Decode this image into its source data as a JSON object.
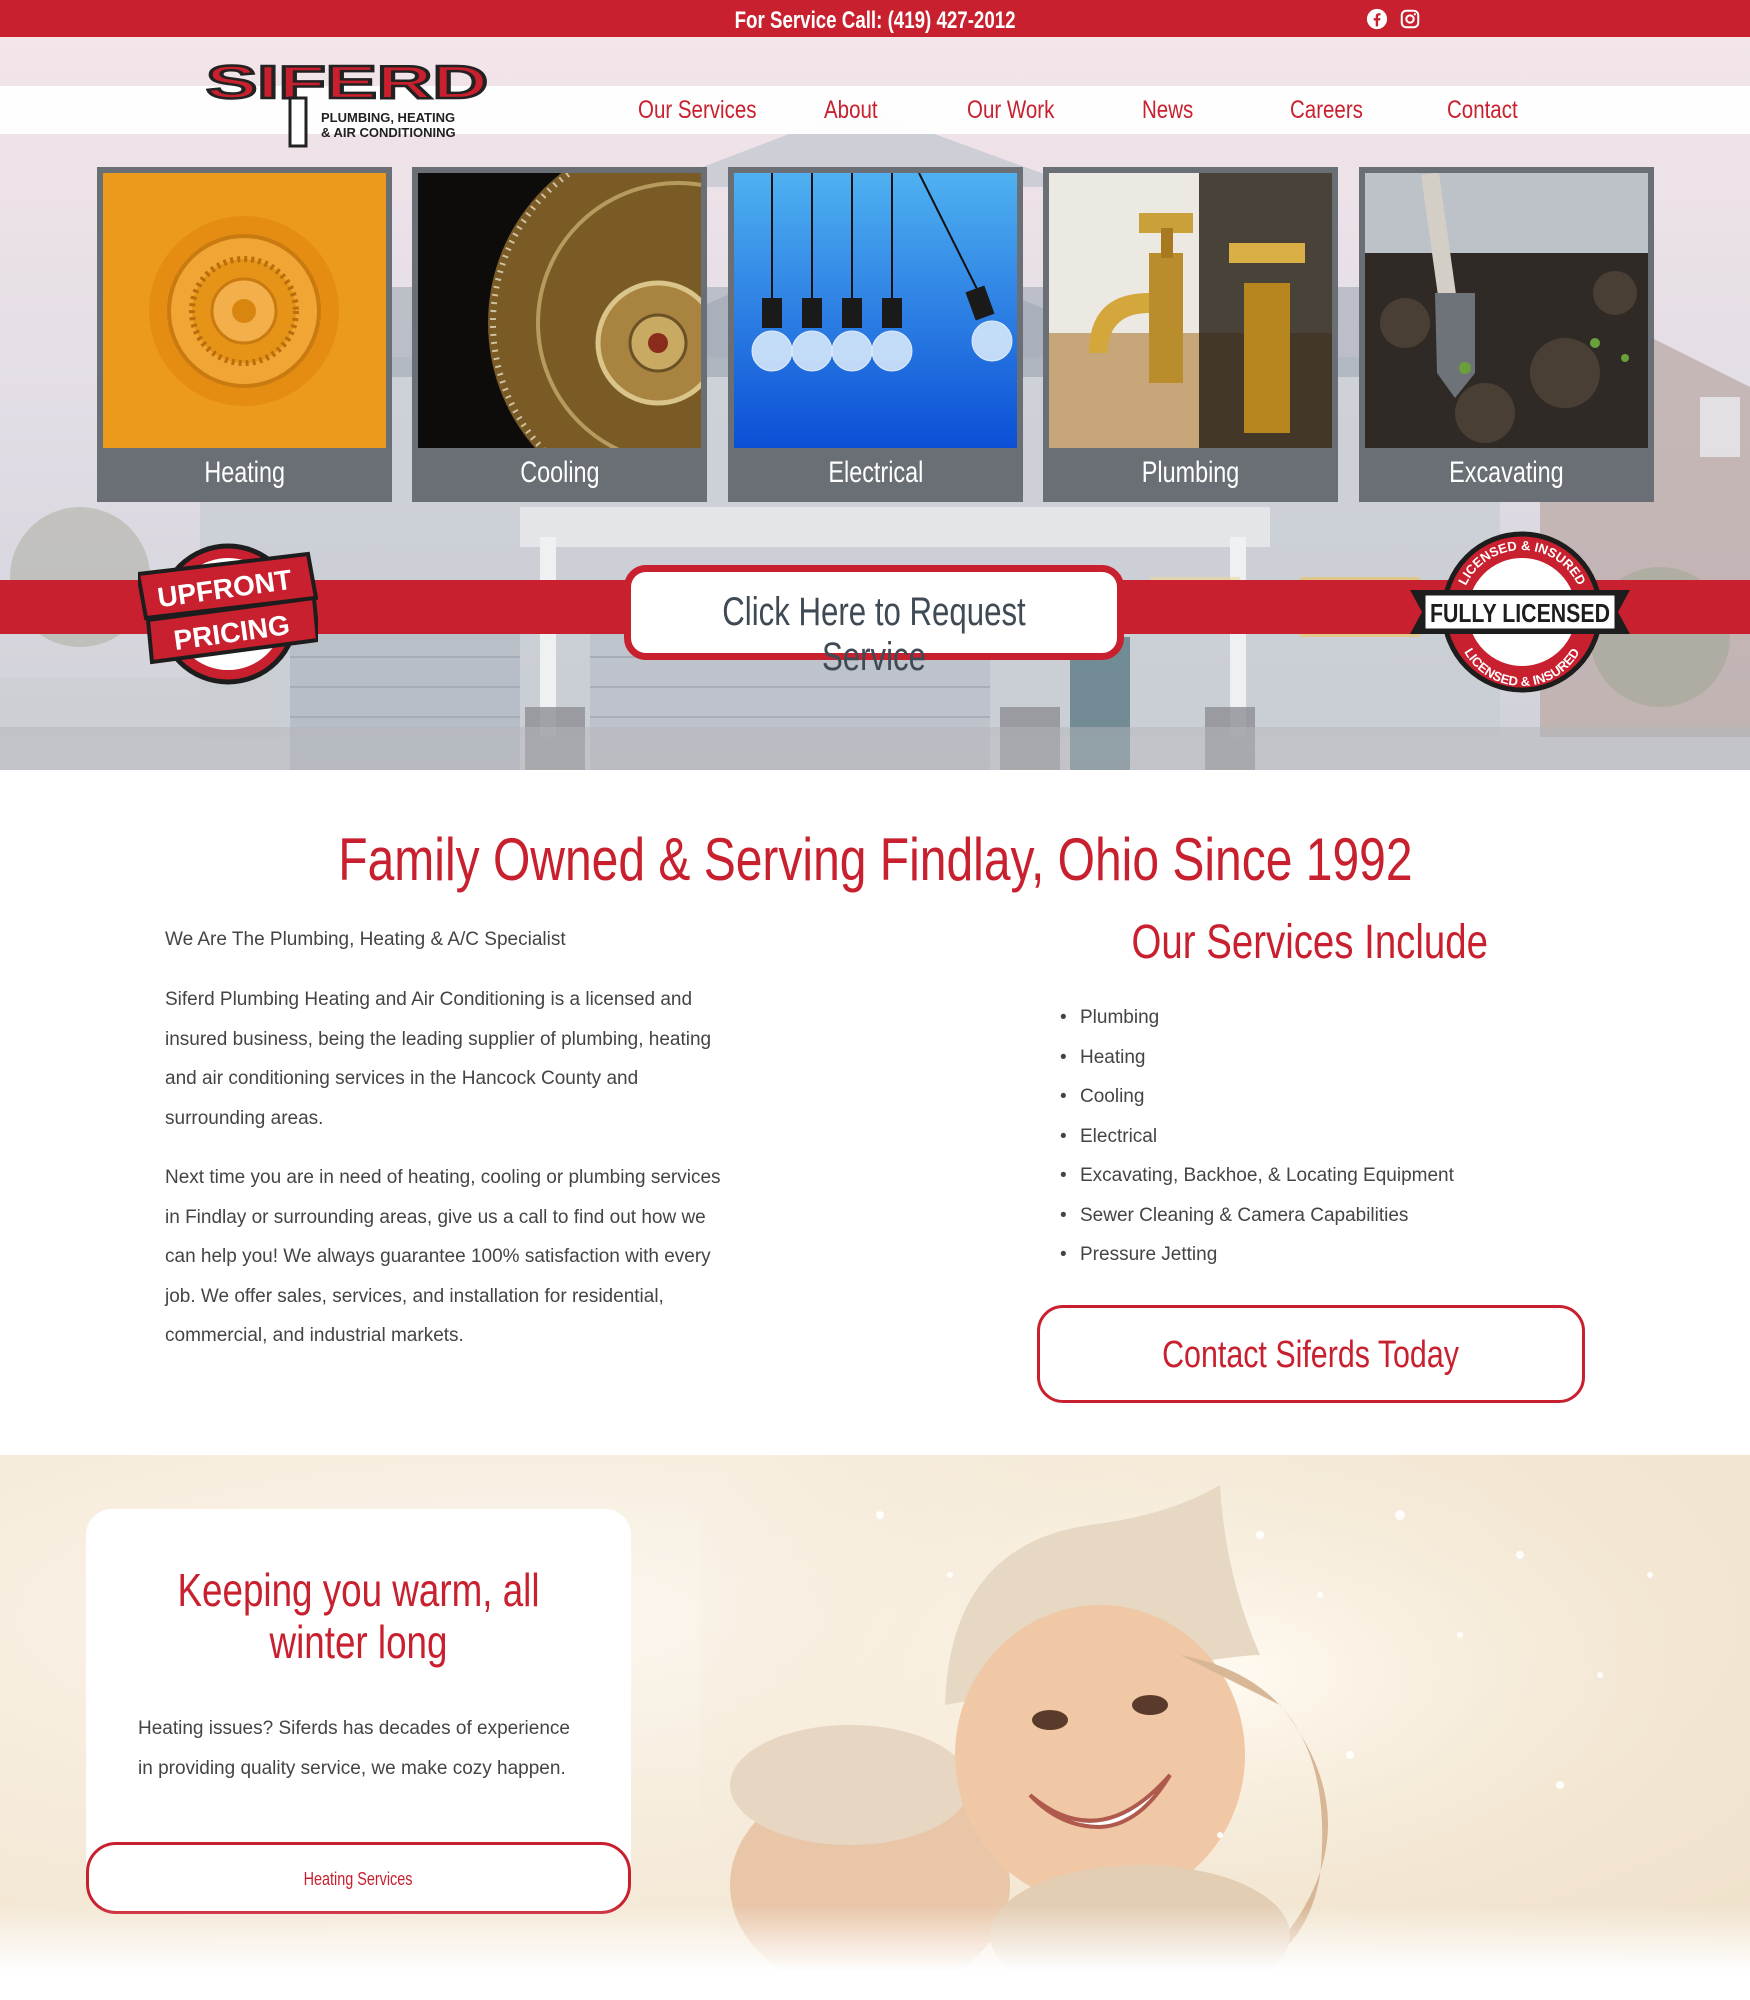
{
  "topbar": {
    "phone_text": "For Service Call: (419) 427-2012",
    "social": [
      "facebook-icon",
      "instagram-icon"
    ]
  },
  "brand": {
    "logo_word": "SIFERD",
    "logo_line1": "PLUMBING, HEATING",
    "logo_line2": "& AIR CONDITIONING",
    "accent_color": "#c8202e",
    "tile_frame_color": "#6a6f75"
  },
  "nav": {
    "items": [
      "Our Services",
      "About",
      "Our Work",
      "News",
      "Careers",
      "Contact"
    ]
  },
  "service_tiles": [
    {
      "label": "Heating",
      "image": "thermostat-dial"
    },
    {
      "label": "Cooling",
      "image": "fan-grille"
    },
    {
      "label": "Electrical",
      "image": "hanging-light-bulbs"
    },
    {
      "label": "Plumbing",
      "image": "brass-faucet"
    },
    {
      "label": "Excavating",
      "image": "shovel-in-soil"
    }
  ],
  "hero": {
    "request_button": "Click Here to Request Service",
    "badge_left": {
      "line1": "UPFRONT",
      "line2": "PRICING"
    },
    "badge_right": {
      "main": "FULLY LICENSED",
      "ring_top": "LICENSED & INSURED",
      "ring_bottom": "LICENSED & INSURED"
    }
  },
  "intro": {
    "heading": "Family Owned & Serving Findlay, Ohio Since 1992",
    "subtitle": "We Are The Plumbing, Heating & A/C Specialist",
    "paragraph1": "Siferd Plumbing Heating and Air Conditioning is a licensed and insured business, being the leading supplier of plumbing, heating and air conditioning services in the Hancock County and surrounding areas.",
    "paragraph2": "Next time you are in need of heating, cooling or plumbing services in Findlay or surrounding areas, give us a call to find out how we can help you! We always guarantee 100% satisfaction with every job. We offer sales, services, and installation for residential, commercial, and industrial markets."
  },
  "services_include": {
    "heading": "Our Services Include",
    "items": [
      "Plumbing",
      "Heating",
      "Cooling",
      "Electrical",
      "Excavating, Backhoe, & Locating Equipment",
      "Sewer Cleaning & Camera Capabilities",
      "Pressure Jetting"
    ],
    "button": "Contact Siferds Today"
  },
  "winter": {
    "heading": "Keeping you warm, all winter long",
    "text": "Heating issues? Siferds has decades of experience in providing quality service, we make cozy happen.",
    "button": "Heating Services"
  }
}
